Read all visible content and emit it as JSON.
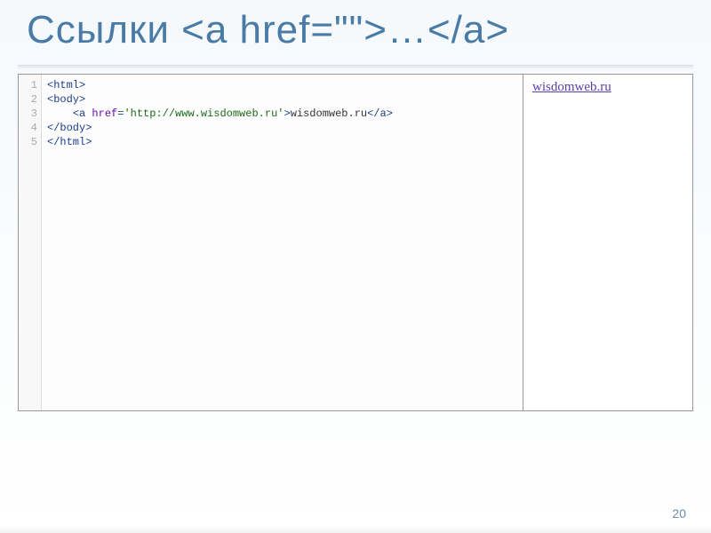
{
  "title": "Ссылки <a href=\"\">…</a>",
  "gutter": [
    "1",
    "2",
    "3",
    "4",
    "5"
  ],
  "code": {
    "l1": {
      "open": "<html>"
    },
    "l2": {
      "open": "<body>"
    },
    "l3": {
      "indent": "    ",
      "open1": "<a ",
      "attr": "href",
      "eq": "=",
      "q1": "'",
      "url": "http://www.wisdomweb.ru",
      "q2": "'",
      "close1": ">",
      "text": "wisdomweb.ru",
      "close2": "</a>"
    },
    "l4": {
      "open": "</body>"
    },
    "l5": {
      "open": "</html>"
    }
  },
  "preview": {
    "link_text": "wisdomweb.ru"
  },
  "page_number": "20"
}
